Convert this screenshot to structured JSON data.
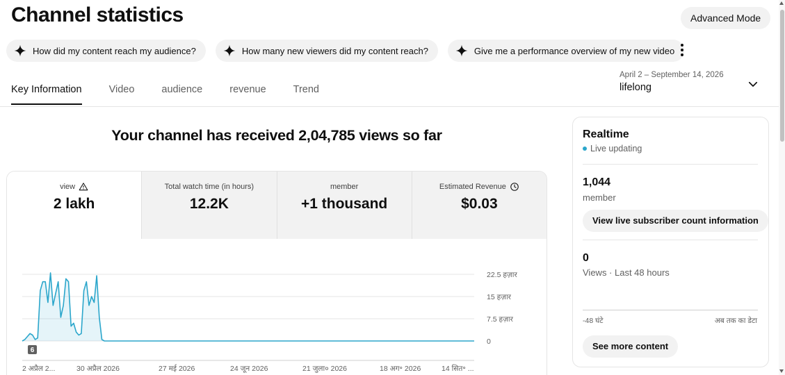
{
  "page": {
    "title": "Channel statistics",
    "advanced_mode_label": "Advanced Mode"
  },
  "chips": [
    {
      "label": "How did my content reach my audience?",
      "icon": "sparkle-icon"
    },
    {
      "label": "How many new viewers did my content reach?",
      "icon": "sparkle-icon"
    },
    {
      "label": "Give me a performance overview of my new video",
      "icon": "sparkle-icon"
    }
  ],
  "tabs": [
    {
      "label": "Key Information",
      "active": true
    },
    {
      "label": "Video"
    },
    {
      "label": "audience"
    },
    {
      "label": "revenue"
    },
    {
      "label": "Trend"
    }
  ],
  "date_filter": {
    "range": "April 2 – September 14, 2026",
    "value": "lifelong"
  },
  "headline": "Your channel has received 2,04,785 views so far",
  "metrics": [
    {
      "label": "view",
      "value": "2 lakh",
      "icon": "warning-icon",
      "selected": true
    },
    {
      "label": "Total watch time (in hours)",
      "value": "12.2K"
    },
    {
      "label": "member",
      "value": "+1 thousand"
    },
    {
      "label": "Estimated Revenue",
      "value": "$0.03",
      "icon": "clock-icon"
    }
  ],
  "chart_data": {
    "type": "area",
    "series": [
      {
        "values": [
          0,
          500,
          1500,
          2500,
          2000,
          500,
          1000,
          17000,
          20000,
          20000,
          13000,
          23000,
          12000,
          16000,
          20000,
          8000,
          12000,
          21000,
          20000,
          5000,
          6000,
          3000,
          2000,
          2500,
          17000,
          20000,
          12000,
          15000,
          13000,
          22000,
          8000,
          500,
          0,
          0,
          0,
          0,
          0,
          0,
          0,
          0,
          0,
          0,
          0,
          0,
          0,
          0,
          0,
          0,
          0,
          0,
          0,
          0,
          0,
          0,
          0,
          0,
          0,
          0,
          0,
          0,
          0,
          0,
          0,
          0,
          0,
          0,
          0,
          0,
          0,
          0,
          0,
          0,
          0,
          0,
          0,
          0,
          0,
          0,
          0,
          0,
          0,
          0,
          0,
          0,
          0,
          0,
          0,
          0,
          0,
          0,
          0,
          0,
          0,
          0,
          0,
          0,
          0,
          0,
          0,
          0,
          0,
          0,
          0,
          0,
          0,
          0,
          0,
          0,
          0,
          0,
          0,
          0,
          0,
          0,
          0,
          0,
          0,
          0,
          0,
          0,
          0,
          0,
          0,
          0,
          0,
          0,
          0,
          0,
          0,
          0,
          0,
          0,
          0,
          0,
          0,
          0,
          0,
          0,
          0,
          0,
          0,
          0,
          0,
          0,
          0,
          0,
          0,
          0,
          0,
          0,
          0,
          0,
          0,
          0,
          0,
          0,
          0,
          0,
          0,
          0,
          0,
          0,
          0,
          0,
          0,
          0,
          0,
          0,
          0,
          0,
          0,
          0,
          0,
          0,
          0,
          0,
          0
        ]
      }
    ],
    "ylim": [
      0,
      22500
    ],
    "y_ticks": [
      "22.5 हज़ार",
      "15 हज़ार",
      "7.5 हज़ार",
      "0"
    ],
    "x_ticks": [
      "2 अप्रैल 2...",
      "30 अप्रैल 2026",
      "27 मई 2026",
      "24 जून 2026",
      "21 जुला० 2026",
      "18 अग॰ 2026",
      "14 सित॰ ..."
    ],
    "marker_label": "6",
    "grid": true,
    "color": "#2ba6cb"
  },
  "realtime": {
    "title": "Realtime",
    "live_label": "Live updating",
    "subscribers": "1,044",
    "subscribers_label": "member",
    "subscriber_button": "View live subscriber count information",
    "views": "0",
    "views_label": "Views · Last 48 hours",
    "axis_left": "-48 घंटे",
    "axis_right": "अब तक का डेटा",
    "more_button": "See more content"
  }
}
